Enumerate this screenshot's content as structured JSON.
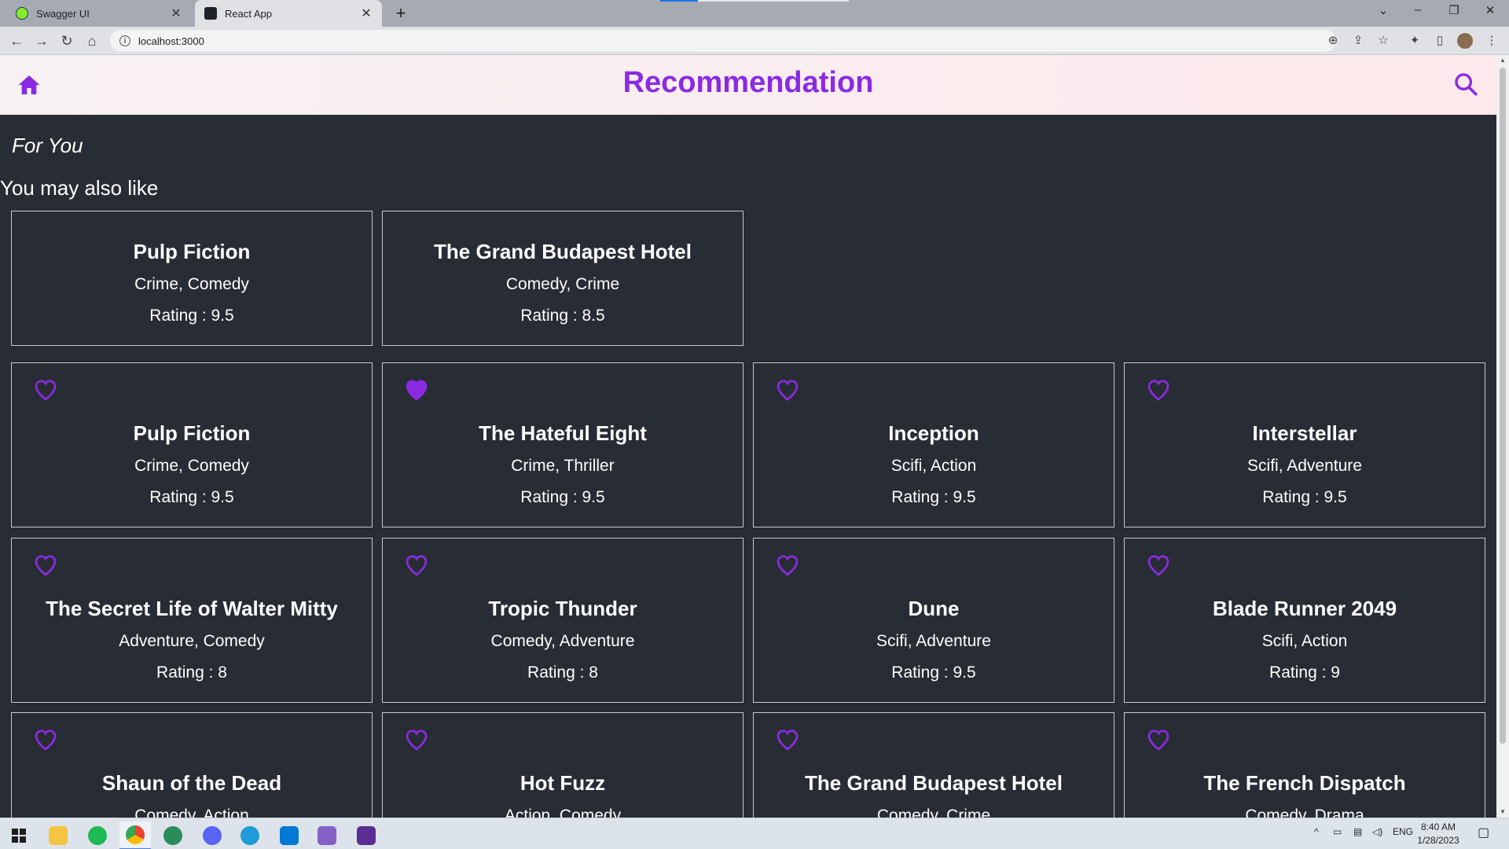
{
  "browser": {
    "tabs": [
      {
        "title": "Swagger UI",
        "active": false
      },
      {
        "title": "React App",
        "active": true
      }
    ],
    "url": "localhost:3000",
    "page_load_progress": 0.2
  },
  "header": {
    "title": "Recommendation",
    "accent_color": "#8a2be2"
  },
  "sections": {
    "for_you": "For You",
    "also_like": "You may also like"
  },
  "recommendations": [
    {
      "title": "Pulp Fiction",
      "genre": "Crime, Comedy",
      "rating": "Rating : 9.5"
    },
    {
      "title": "The Grand Budapest Hotel",
      "genre": "Comedy, Crime",
      "rating": "Rating : 8.5"
    }
  ],
  "movies": [
    {
      "title": "Pulp Fiction",
      "genre": "Crime, Comedy",
      "rating": "Rating : 9.5",
      "liked": false
    },
    {
      "title": "The Hateful Eight",
      "genre": "Crime, Thriller",
      "rating": "Rating : 9.5",
      "liked": true
    },
    {
      "title": "Inception",
      "genre": "Scifi, Action",
      "rating": "Rating : 9.5",
      "liked": false
    },
    {
      "title": "Interstellar",
      "genre": "Scifi, Adventure",
      "rating": "Rating : 9.5",
      "liked": false
    },
    {
      "title": "The Secret Life of Walter Mitty",
      "genre": "Adventure, Comedy",
      "rating": "Rating : 8",
      "liked": false
    },
    {
      "title": "Tropic Thunder",
      "genre": "Comedy, Adventure",
      "rating": "Rating : 8",
      "liked": false
    },
    {
      "title": "Dune",
      "genre": "Scifi, Adventure",
      "rating": "Rating : 9.5",
      "liked": false
    },
    {
      "title": "Blade Runner 2049",
      "genre": "Scifi, Action",
      "rating": "Rating : 9",
      "liked": false
    },
    {
      "title": "Shaun of the Dead",
      "genre": "Comedy, Action",
      "rating": "",
      "liked": false
    },
    {
      "title": "Hot Fuzz",
      "genre": "Action, Comedy",
      "rating": "",
      "liked": false
    },
    {
      "title": "The Grand Budapest Hotel",
      "genre": "Comedy, Crime",
      "rating": "",
      "liked": false
    },
    {
      "title": "The French Dispatch",
      "genre": "Comedy, Drama",
      "rating": "",
      "liked": false
    }
  ],
  "taskbar": {
    "apps": [
      "start-icon",
      "file-explorer-icon",
      "spotify-icon",
      "chrome-icon",
      "edge-icon",
      "discord-icon",
      "edge-dev-icon",
      "vscode-icon",
      "visual-studio-icon",
      "terminal-icon"
    ],
    "language": "ENG",
    "time": "8:40 AM",
    "date": "1/28/2023"
  }
}
